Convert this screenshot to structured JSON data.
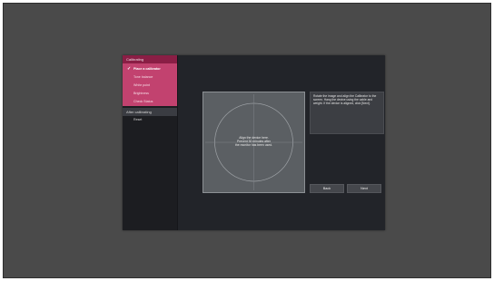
{
  "sidebar": {
    "calibrating_header": "Calibrating",
    "steps": [
      {
        "label": "Place a calibrator"
      },
      {
        "label": "Tone balance"
      },
      {
        "label": "White point"
      },
      {
        "label": "Brightness"
      },
      {
        "label": "Check Status"
      }
    ],
    "after_header": "After calibrating",
    "after_items": [
      {
        "label": "Reset"
      }
    ]
  },
  "calibration": {
    "instruction_lines": [
      "Align the device here.",
      "Prevent 30 minutes after",
      "the monitor has been used."
    ]
  },
  "info": {
    "text": "Rotate the image and align the Calibrator to the screen. Hang the device using the cable and weight. If the device is aligned, click [Next]."
  },
  "buttons": {
    "back_label": "Back",
    "next_label": "Next"
  },
  "colors": {
    "accent": "#c2426f",
    "accent_dark": "#8a1e45",
    "panel": "#222429",
    "background": "#4a4a4a"
  }
}
